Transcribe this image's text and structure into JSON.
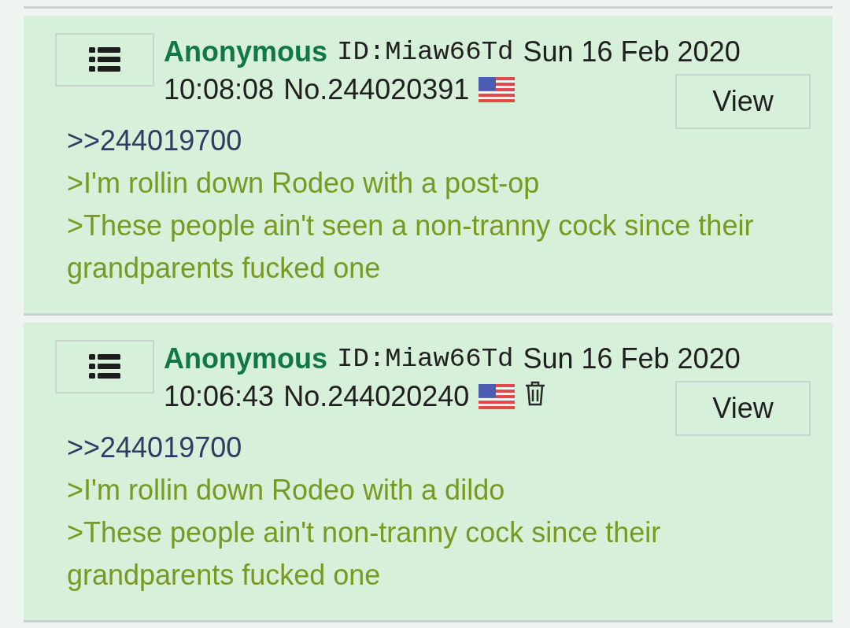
{
  "posts": [
    {
      "name": "Anonymous",
      "id": "ID:Miaw66Td",
      "date": "Sun 16 Feb 2020",
      "time": "10:08:08",
      "number": "No.244020391",
      "deletable": false,
      "view_button": "View",
      "lines": [
        {
          "kind": "quotelink",
          "text": ">>244019700"
        },
        {
          "kind": "greentext",
          "text": ">I'm rollin down Rodeo with a post-op"
        },
        {
          "kind": "greentext",
          "text": ">These people ain't seen a non-tranny cock since their grandparents fucked one"
        }
      ]
    },
    {
      "name": "Anonymous",
      "id": "ID:Miaw66Td",
      "date": "Sun 16 Feb 2020",
      "time": "10:06:43",
      "number": "No.244020240",
      "deletable": true,
      "view_button": "View",
      "lines": [
        {
          "kind": "quotelink",
          "text": ">>244019700"
        },
        {
          "kind": "greentext",
          "text": ">I'm rollin down Rodeo with a dildo"
        },
        {
          "kind": "greentext",
          "text": ">These people ain't non-tranny cock since their grandparents fucked one"
        }
      ]
    }
  ]
}
